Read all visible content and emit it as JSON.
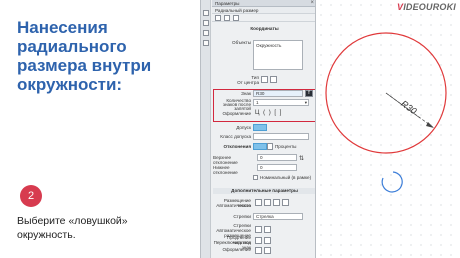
{
  "slide": {
    "title": "Нанесения\nрадиального\nразмера внутри\nокружности:",
    "step_number": "2",
    "step_text": "Выберите «ловушкой»\nокружность."
  },
  "logo": {
    "text": "VIDEOUROKI",
    "suffix": ".net"
  },
  "panel": {
    "title": "Параметры",
    "subtitle": "Радиальный размер",
    "section_coordinates": "Координаты",
    "objects_label": "Объекты",
    "objects_value": "Окружность",
    "type_label": "Тип",
    "from_center_label": "От центра",
    "text_label": "Знак",
    "text_value": "R30",
    "shelf_count_label": "Количество знаков после запятой",
    "shelf_count_value": "1",
    "design_label": "Оформление",
    "design_glyphs": "Ц ( ) [ ]",
    "tolerance_label": "Допуск",
    "tolerance_class_label": "Класс допуска",
    "deviations_label": "Отклонения",
    "percent_label": "Проценты",
    "upper_dev_label": "Верхнее отклонение",
    "upper_dev_value": "0",
    "lower_dev_label": "Нижнее отклонение",
    "lower_dev_value": "0",
    "nominal_label": "Номинальный (в рамке)",
    "section_extra": "Дополнительные параметры",
    "placement_label": "Размещение текста",
    "auto_label": "Автоматическое",
    "arrows_label": "Стрелки",
    "arrows_value": "Стрелка",
    "arrows2_label": "Стрелки",
    "auto_placement_label": "Автоматическое размещение",
    "ext_line_label": "Продление надписи",
    "leader_label": "Переключить под знак",
    "landing_label": "Оформление"
  },
  "drawing": {
    "dimension_text": "R30",
    "circle_color": "#e0393a",
    "cursor_color": "#3b7dd8"
  }
}
